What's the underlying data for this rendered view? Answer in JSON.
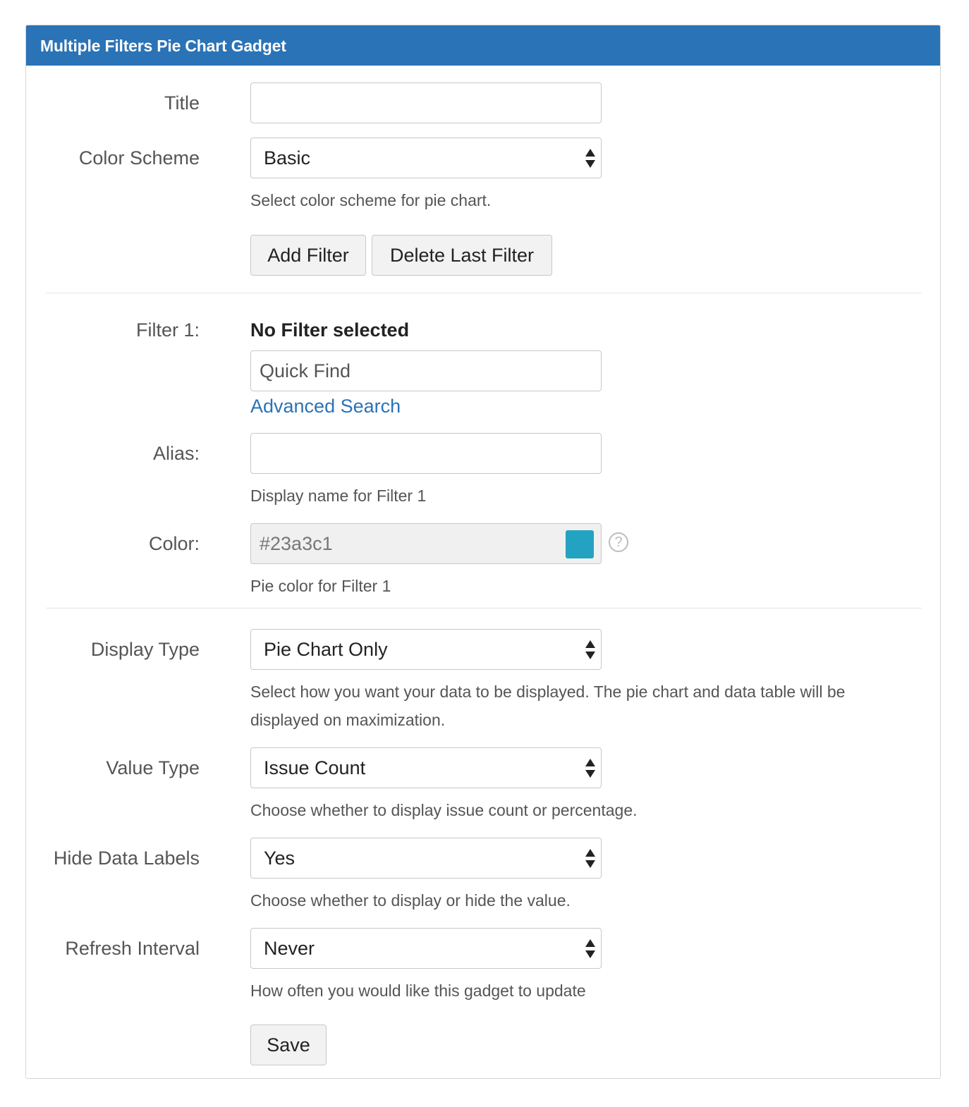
{
  "header": {
    "title": "Multiple Filters Pie Chart Gadget"
  },
  "form": {
    "title": {
      "label": "Title",
      "value": ""
    },
    "color_scheme": {
      "label": "Color Scheme",
      "value": "Basic",
      "help": "Select color scheme for pie chart."
    },
    "buttons": {
      "add_filter": "Add Filter",
      "delete_last_filter": "Delete Last Filter"
    },
    "filter1": {
      "label": "Filter 1:",
      "selection": "No Filter selected",
      "quick_find_placeholder": "Quick Find",
      "advanced_search": "Advanced Search",
      "alias": {
        "label": "Alias:",
        "value": "",
        "help": "Display name for Filter 1"
      },
      "color": {
        "label": "Color:",
        "value": "#23a3c1",
        "help": "Pie color for Filter 1",
        "swatch": "#23a3c1",
        "help_icon": "question-circle-icon"
      }
    },
    "display_type": {
      "label": "Display Type",
      "value": "Pie Chart Only",
      "help": "Select how you want your data to be displayed. The pie chart and data table will be displayed on maximization."
    },
    "value_type": {
      "label": "Value Type",
      "value": "Issue Count",
      "help": "Choose whether to display issue count or percentage."
    },
    "hide_data_labels": {
      "label": "Hide Data Labels",
      "value": "Yes",
      "help": "Choose whether to display or hide the value."
    },
    "refresh_interval": {
      "label": "Refresh Interval",
      "value": "Never",
      "help": "How often you would like this gadget to update"
    },
    "save": "Save"
  },
  "colors": {
    "header": "#2a73b6",
    "link": "#2a73b6"
  }
}
